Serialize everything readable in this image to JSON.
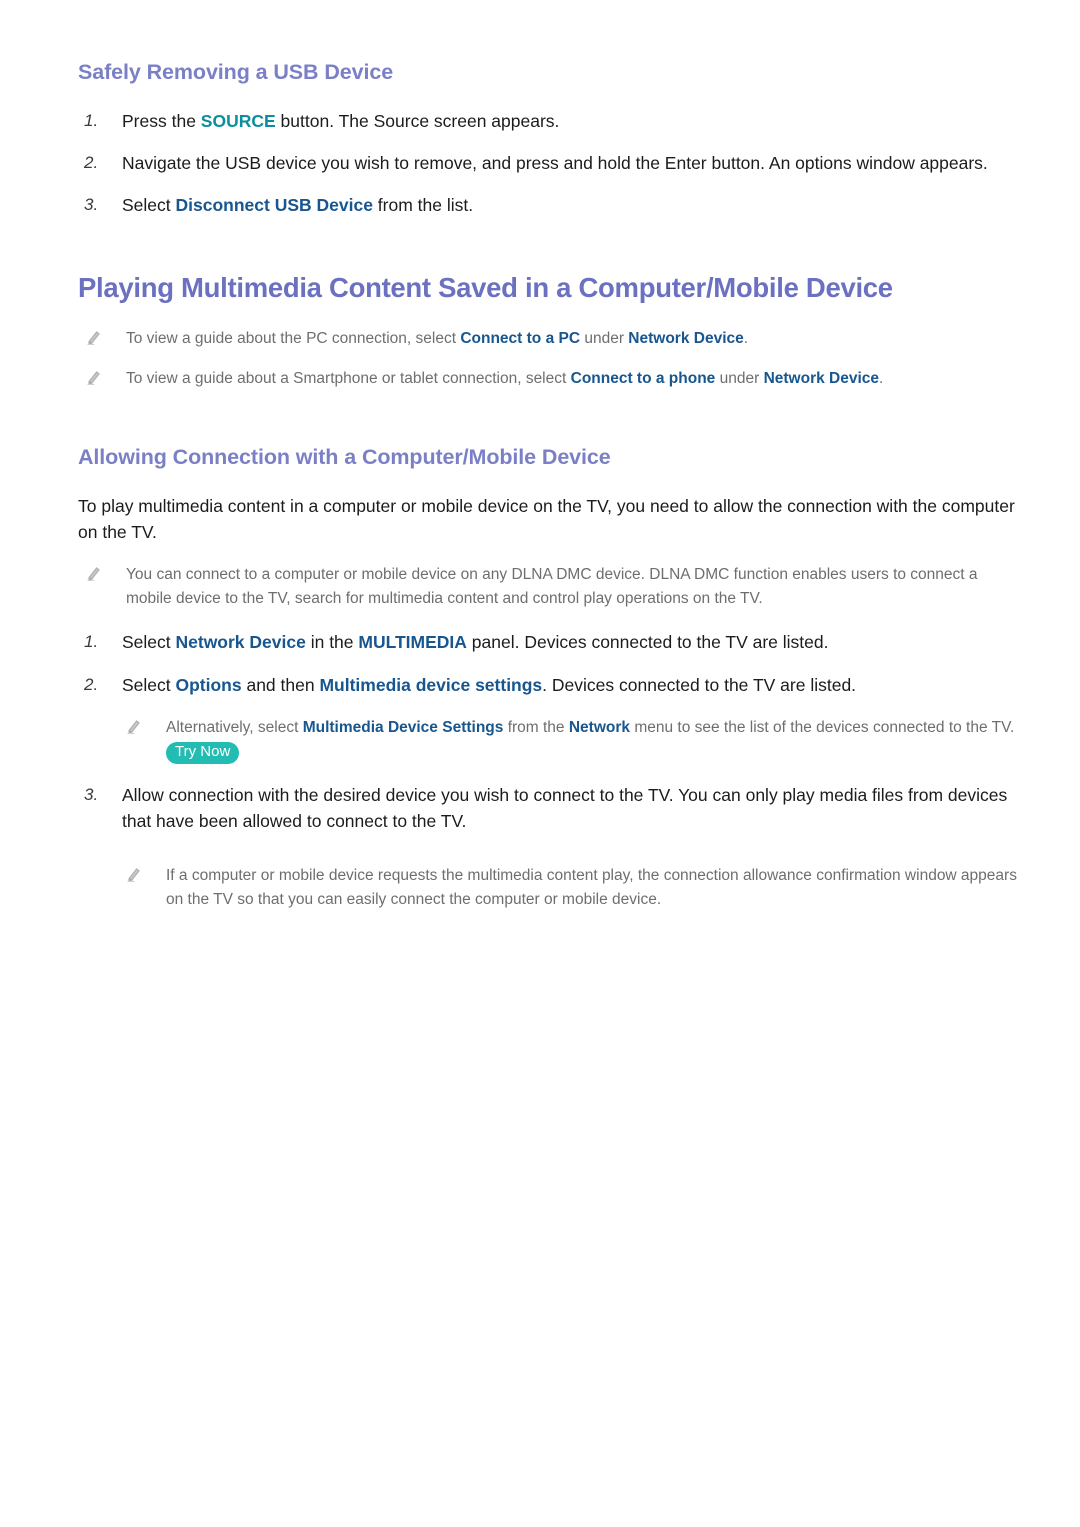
{
  "document": {
    "section1": {
      "heading": "Safely Removing a USB Device",
      "steps": [
        {
          "num": "1.",
          "parts": [
            {
              "t": "Press the ",
              "s": "plain"
            },
            {
              "t": "SOURCE",
              "s": "teal"
            },
            {
              "t": " button. The Source screen appears.",
              "s": "plain"
            }
          ]
        },
        {
          "num": "2.",
          "parts": [
            {
              "t": "Navigate the USB device you wish to remove, and press and hold the Enter button. An options window appears.",
              "s": "plain"
            }
          ]
        },
        {
          "num": "3.",
          "parts": [
            {
              "t": "Select ",
              "s": "plain"
            },
            {
              "t": "Disconnect USB Device",
              "s": "blue"
            },
            {
              "t": " from the list.",
              "s": "plain"
            }
          ]
        }
      ]
    },
    "section2": {
      "heading": "Playing Multimedia Content Saved in a Computer/Mobile Device",
      "notes": [
        {
          "icon": "pencil-icon",
          "parts": [
            {
              "t": "To view a guide about the PC connection, select ",
              "s": "plain"
            },
            {
              "t": "Connect to a PC",
              "s": "blue"
            },
            {
              "t": " under ",
              "s": "plain"
            },
            {
              "t": "Network Device",
              "s": "blue"
            },
            {
              "t": ".",
              "s": "plain"
            }
          ]
        },
        {
          "icon": "pencil-icon",
          "parts": [
            {
              "t": "To view a guide about a Smartphone or tablet connection, select ",
              "s": "plain"
            },
            {
              "t": "Connect to a phone",
              "s": "blue"
            },
            {
              "t": " under ",
              "s": "plain"
            },
            {
              "t": "Network Device",
              "s": "blue"
            },
            {
              "t": ".",
              "s": "plain"
            }
          ]
        }
      ]
    },
    "section3": {
      "heading": "Allowing Connection with a Computer/Mobile Device",
      "intro": "To play multimedia content in a computer or mobile device on the TV, you need to allow the connection with the computer on the TV.",
      "note_top": {
        "icon": "pencil-icon",
        "parts": [
          {
            "t": "You can connect to a computer or mobile device on any DLNA DMC device. DLNA DMC function enables users to connect a mobile device to the TV, search for multimedia content and control play operations on the TV.",
            "s": "plain"
          }
        ]
      },
      "steps": [
        {
          "num": "1.",
          "parts": [
            {
              "t": "Select ",
              "s": "plain"
            },
            {
              "t": "Network Device",
              "s": "blue"
            },
            {
              "t": " in the ",
              "s": "plain"
            },
            {
              "t": "MULTIMEDIA",
              "s": "blue"
            },
            {
              "t": " panel. Devices connected to the TV are listed.",
              "s": "plain"
            }
          ]
        },
        {
          "num": "2.",
          "parts": [
            {
              "t": "Select ",
              "s": "plain"
            },
            {
              "t": "Options",
              "s": "blue"
            },
            {
              "t": " and then ",
              "s": "plain"
            },
            {
              "t": "Multimedia device settings",
              "s": "blue"
            },
            {
              "t": ". Devices connected to the TV are listed.",
              "s": "plain"
            }
          ]
        },
        {
          "num": "3.",
          "parts": [
            {
              "t": "Allow connection with the desired device you wish to connect to the TV. You can only play media files from devices that have been allowed to connect to the TV.",
              "s": "plain"
            }
          ]
        }
      ],
      "note_after_step2": {
        "icon": "pencil-icon",
        "parts": [
          {
            "t": "Alternatively, select ",
            "s": "plain"
          },
          {
            "t": "Multimedia Device Settings",
            "s": "blue"
          },
          {
            "t": " from the ",
            "s": "plain"
          },
          {
            "t": "Network",
            "s": "blue"
          },
          {
            "t": " menu to see the list of the devices connected to the TV. ",
            "s": "plain"
          },
          {
            "t": "Try Now",
            "s": "trynow"
          }
        ]
      },
      "note_after_step3": {
        "icon": "pencil-icon",
        "parts": [
          {
            "t": "If a computer or mobile device requests the multimedia content play, the connection allowance confirmation window appears on the TV so that you can easily connect the computer or mobile device.",
            "s": "plain"
          }
        ]
      }
    },
    "colors": {
      "heading_purple": "#7b80c6",
      "main_heading_purple": "#6b70c0",
      "link_blue": "#18568f",
      "accent_teal": "#0b8e9f",
      "trynow_badge": "#23bcb3",
      "note_gray": "#6e6e6e",
      "body_text": "#1c1c1c"
    }
  }
}
